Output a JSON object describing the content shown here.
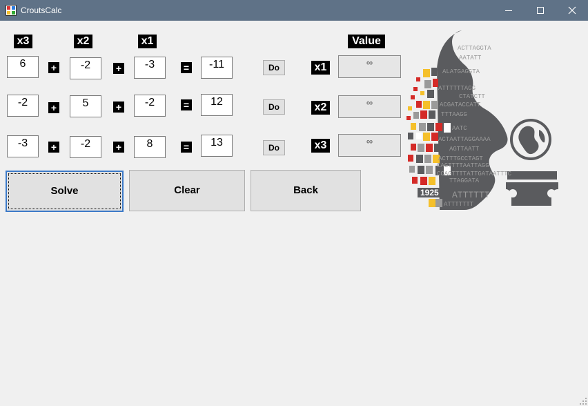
{
  "window": {
    "title": "CroutsCalc",
    "controls": {
      "minimize": "minimize-icon",
      "maximize": "maximize-icon",
      "close": "close-icon"
    }
  },
  "headers": {
    "x3": "x3",
    "x2": "x2",
    "x1": "x1",
    "value": "Value"
  },
  "operators": {
    "plus": "+",
    "equals": "="
  },
  "rows": [
    {
      "x3": "6",
      "x2": "-2",
      "x1": "-3",
      "rhs": "-11",
      "do_label": "Do",
      "var_label": "x1",
      "value": "∞"
    },
    {
      "x3": "-2",
      "x2": "5",
      "x1": "-2",
      "rhs": "12",
      "do_label": "Do",
      "var_label": "x2",
      "value": "∞"
    },
    {
      "x3": "-3",
      "x2": "-2",
      "x1": "8",
      "rhs": "13",
      "do_label": "Do",
      "var_label": "x3",
      "value": "∞"
    }
  ],
  "buttons": {
    "solve": "Solve",
    "clear": "Clear",
    "back": "Back"
  },
  "logo": {
    "year": "1925",
    "dna_lines": [
      "ACTTAGGTA",
      "AATATT",
      "ALATGAGGTA",
      "ATTTTTTAGG",
      "CTATCTT",
      "ACGATACCATT",
      "TTTAAGG",
      "AATC",
      "ACTAATTAGGAAAA",
      "AGTTAATT",
      "ACTTTGCCTAGT",
      "CAGTTTTAATTAGG",
      "CCAGTTTTATTGATAATTTC",
      "TTAGGATA",
      "ATTTTTT",
      "ATTTTTTT"
    ]
  },
  "colors": {
    "titlebar": "#5f7287",
    "background": "#f0f0f0",
    "label_bg": "#000000",
    "focus": "#3c7ac8",
    "logo_gray": "#5a5b5e",
    "logo_red": "#d42a27",
    "logo_yellow": "#f5c02b"
  }
}
